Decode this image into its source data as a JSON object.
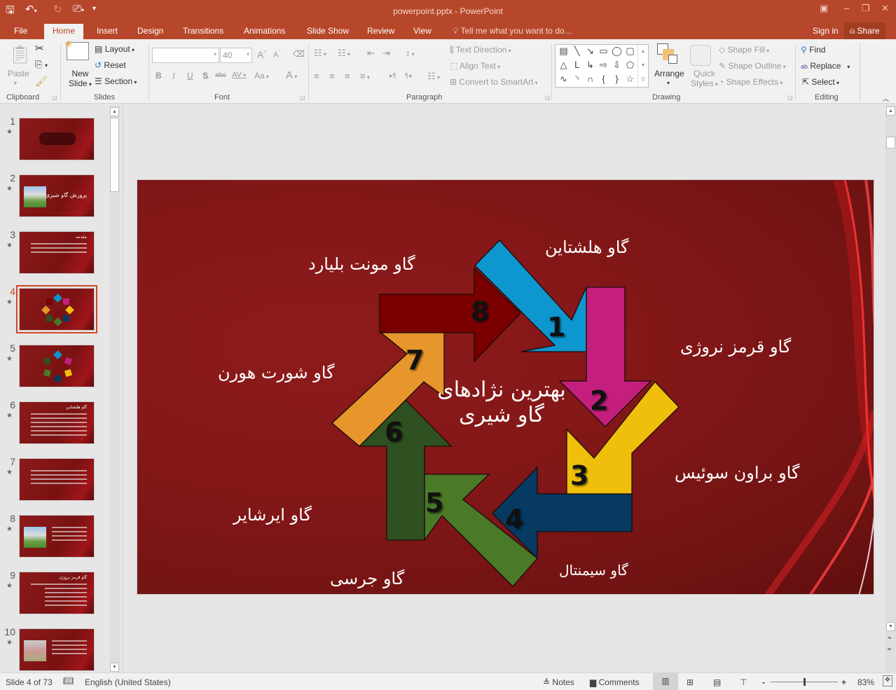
{
  "window": {
    "title": "powerpoint.pptx - PowerPoint",
    "qat": [
      {
        "name": "save-icon",
        "glyph": "🖫"
      },
      {
        "name": "undo-icon",
        "glyph": "↶"
      },
      {
        "name": "redo-icon",
        "glyph": "↻"
      },
      {
        "name": "start-from-beginning-icon",
        "glyph": "⎚"
      },
      {
        "name": "customize-qat-icon",
        "glyph": "⩡"
      }
    ],
    "controls": {
      "ribbon_display": "▣",
      "minimize": "–",
      "restore": "❐",
      "close": "✕"
    }
  },
  "tabs": [
    "File",
    "Home",
    "Insert",
    "Design",
    "Transitions",
    "Animations",
    "Slide Show",
    "Review",
    "View"
  ],
  "active_tab": "Home",
  "tell_me": "Tell me what you want to do...",
  "sign_in": "Sign in",
  "share": "Share",
  "ribbon": {
    "clipboard": {
      "label": "Clipboard",
      "paste": "Paste"
    },
    "slides": {
      "label": "Slides",
      "new_slide_1": "New",
      "new_slide_2": "Slide",
      "layout": "Layout",
      "reset": "Reset",
      "section": "Section"
    },
    "font": {
      "label": "Font",
      "font_name": "",
      "font_size": "40",
      "bold": "B",
      "italic": "I",
      "underline": "U",
      "shadow": "S",
      "strike": "abc",
      "spacing": "AV",
      "case": "Aa",
      "color": "A",
      "grow": "A",
      "shrink": "A"
    },
    "paragraph": {
      "label": "Paragraph",
      "text_direction": "Text Direction",
      "align_text": "Align Text",
      "convert_smartart": "Convert to SmartArt"
    },
    "drawing": {
      "label": "Drawing",
      "arrange": "Arrange",
      "quick_styles_1": "Quick",
      "quick_styles_2": "Styles",
      "shape_fill": "Shape Fill",
      "shape_outline": "Shape Outline",
      "shape_effects": "Shape Effects",
      "shapes": [
        "▤",
        "╲",
        "↘",
        "▭",
        "◯",
        "▢",
        "△",
        "ᒪ",
        "↳",
        "⇨",
        "⇩",
        "⬠",
        "∿",
        "◝",
        "∩",
        "{",
        "}",
        "☆"
      ]
    },
    "editing": {
      "label": "Editing",
      "find": "Find",
      "replace": "Replace",
      "select": "Select"
    }
  },
  "thumbnails": [
    {
      "num": "1",
      "title": ""
    },
    {
      "num": "2",
      "title": "پرورش گاو شیری"
    },
    {
      "num": "3",
      "title": "مقدمه"
    },
    {
      "num": "4",
      "title": "",
      "selected": true
    },
    {
      "num": "5",
      "title": ""
    },
    {
      "num": "6",
      "title": "گاو هلشتاین"
    },
    {
      "num": "7",
      "title": ""
    },
    {
      "num": "8",
      "title": ""
    },
    {
      "num": "9",
      "title": "گاو قرمز نروژی"
    },
    {
      "num": "10",
      "title": ""
    }
  ],
  "slide": {
    "center_title": "بهترین نژادهای گاو شیری",
    "breeds": [
      {
        "num": "1",
        "label": "گاو هلشتاین",
        "color": "#0e96cf"
      },
      {
        "num": "2",
        "label": "گاو قرمز نروژی",
        "color": "#c41f7c"
      },
      {
        "num": "3",
        "label": "گاو براون سوئیس",
        "color": "#efbf0b"
      },
      {
        "num": "4",
        "label": "گاو سیمنتال",
        "color": "#063a60"
      },
      {
        "num": "5",
        "label": "گاو جرسی",
        "color": "#4a7a28"
      },
      {
        "num": "6",
        "label": "گاو ایرشایر",
        "color": "#2f5020"
      },
      {
        "num": "7",
        "label": "گاو شورت هورن",
        "color": "#e6962a"
      },
      {
        "num": "8",
        "label": "گاو مونت بلیارد",
        "color": "#7a0000"
      }
    ]
  },
  "status": {
    "slide_of": "Slide 4 of 73",
    "language": "English (United States)",
    "notes": "Notes",
    "comments": "Comments",
    "zoom": "83%",
    "zoom_fraction": 0.5
  }
}
